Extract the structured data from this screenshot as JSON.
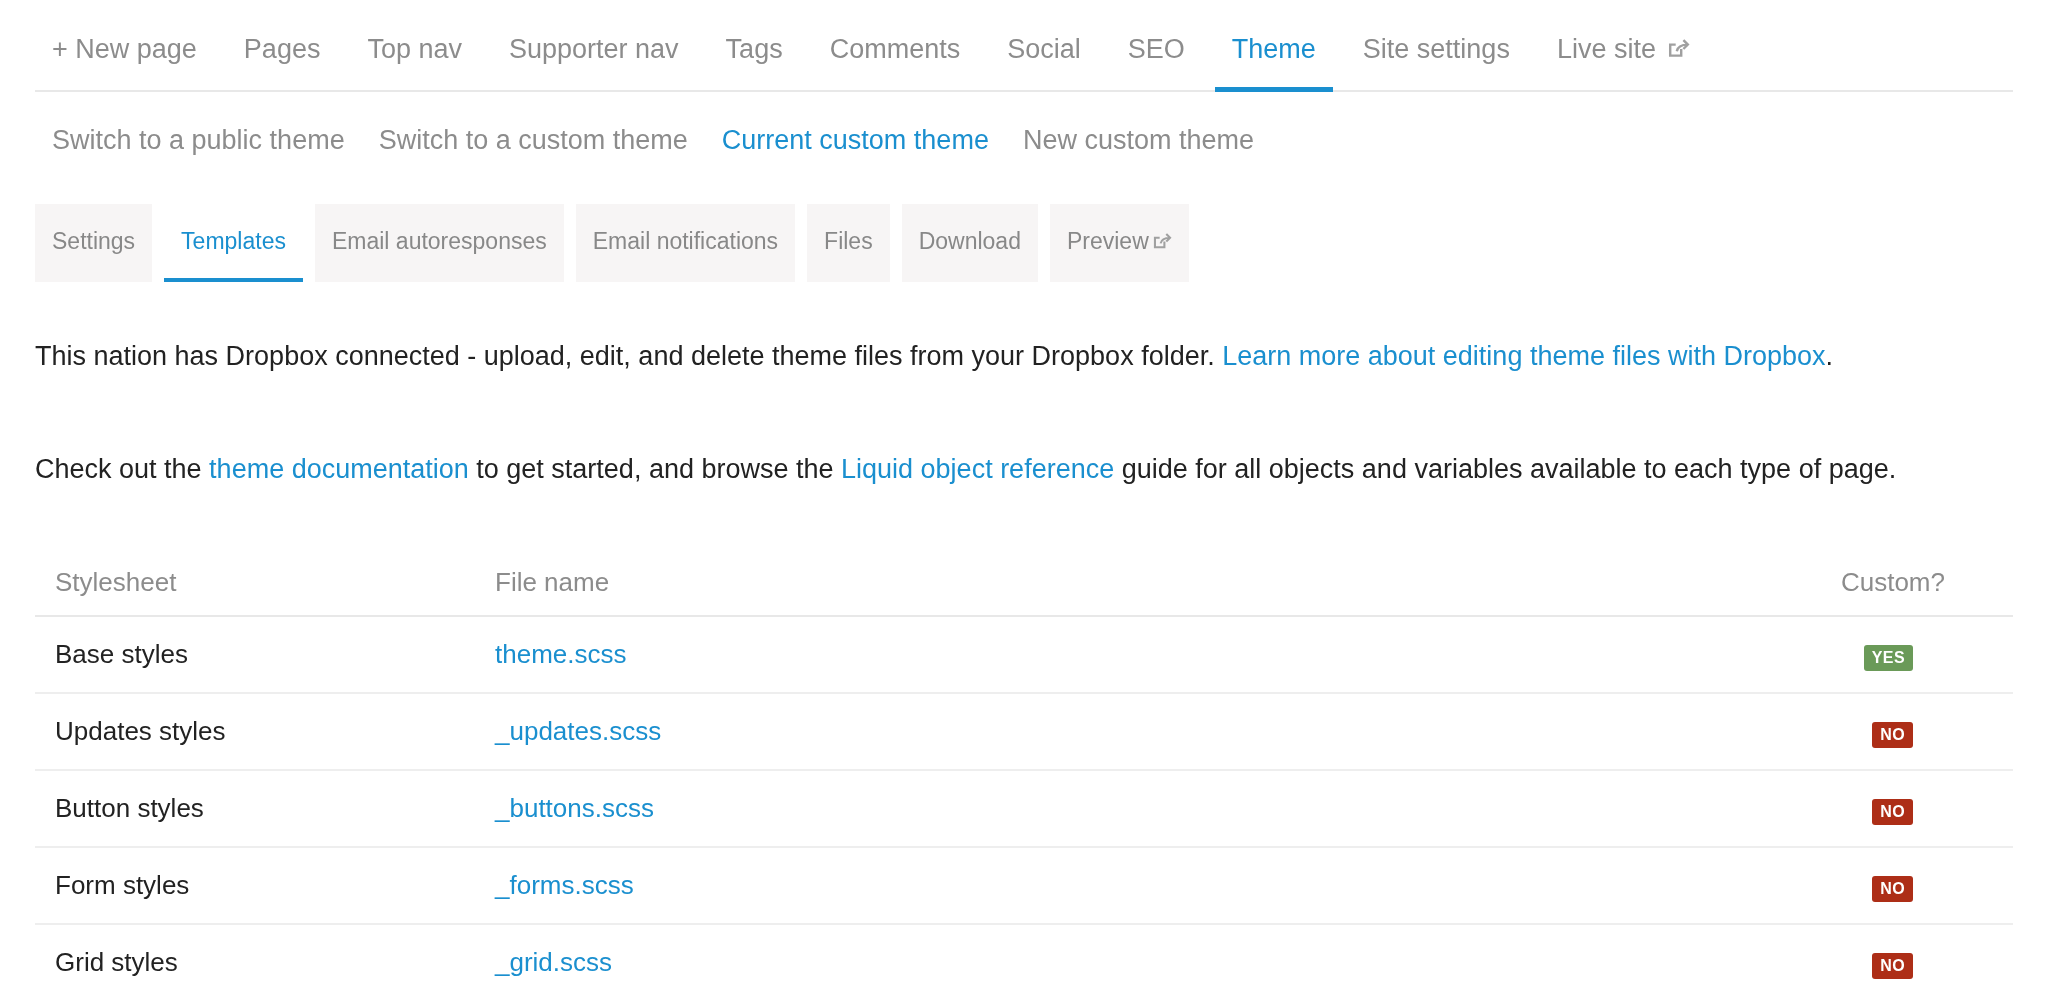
{
  "top_nav": [
    {
      "label": "+ New page",
      "selected": false,
      "external": false
    },
    {
      "label": "Pages",
      "selected": false,
      "external": false
    },
    {
      "label": "Top nav",
      "selected": false,
      "external": false
    },
    {
      "label": "Supporter nav",
      "selected": false,
      "external": false
    },
    {
      "label": "Tags",
      "selected": false,
      "external": false
    },
    {
      "label": "Comments",
      "selected": false,
      "external": false
    },
    {
      "label": "Social",
      "selected": false,
      "external": false
    },
    {
      "label": "SEO",
      "selected": false,
      "external": false
    },
    {
      "label": "Theme",
      "selected": true,
      "external": false
    },
    {
      "label": "Site settings",
      "selected": false,
      "external": false
    },
    {
      "label": "Live site",
      "selected": false,
      "external": true
    }
  ],
  "sub_nav": [
    {
      "label": "Switch to a public theme",
      "selected": false
    },
    {
      "label": "Switch to a custom theme",
      "selected": false
    },
    {
      "label": "Current custom theme",
      "selected": true
    },
    {
      "label": "New custom theme",
      "selected": false
    }
  ],
  "tabs": [
    {
      "label": "Settings",
      "selected": false,
      "external": false
    },
    {
      "label": "Templates",
      "selected": true,
      "external": false
    },
    {
      "label": "Email autoresponses",
      "selected": false,
      "external": false
    },
    {
      "label": "Email notifications",
      "selected": false,
      "external": false
    },
    {
      "label": "Files",
      "selected": false,
      "external": false
    },
    {
      "label": "Download",
      "selected": false,
      "external": false
    },
    {
      "label": "Preview",
      "selected": false,
      "external": true
    }
  ],
  "paragraphs": [
    [
      {
        "text": "This nation has Dropbox connected - upload, edit, and delete theme files from your Dropbox folder. ",
        "link": false
      },
      {
        "text": "Learn more about editing theme files with Dropbox",
        "link": true
      },
      {
        "text": ".",
        "link": false
      }
    ],
    [
      {
        "text": "Check out the ",
        "link": false
      },
      {
        "text": "theme documentation",
        "link": true
      },
      {
        "text": " to get started, and browse the ",
        "link": false
      },
      {
        "text": "Liquid object reference",
        "link": true
      },
      {
        "text": " guide for all objects and variables available to each type of page.",
        "link": false
      }
    ]
  ],
  "table": {
    "columns": [
      "Stylesheet",
      "File name",
      "Custom?"
    ],
    "rows": [
      {
        "stylesheet": "Base styles",
        "file": "theme.scss",
        "custom": true,
        "badge": "YES"
      },
      {
        "stylesheet": "Updates styles",
        "file": "_updates.scss",
        "custom": false,
        "badge": "NO"
      },
      {
        "stylesheet": "Button styles",
        "file": "_buttons.scss",
        "custom": false,
        "badge": "NO"
      },
      {
        "stylesheet": "Form styles",
        "file": "_forms.scss",
        "custom": false,
        "badge": "NO"
      },
      {
        "stylesheet": "Grid styles",
        "file": "_grid.scss",
        "custom": false,
        "badge": "NO"
      }
    ]
  }
}
